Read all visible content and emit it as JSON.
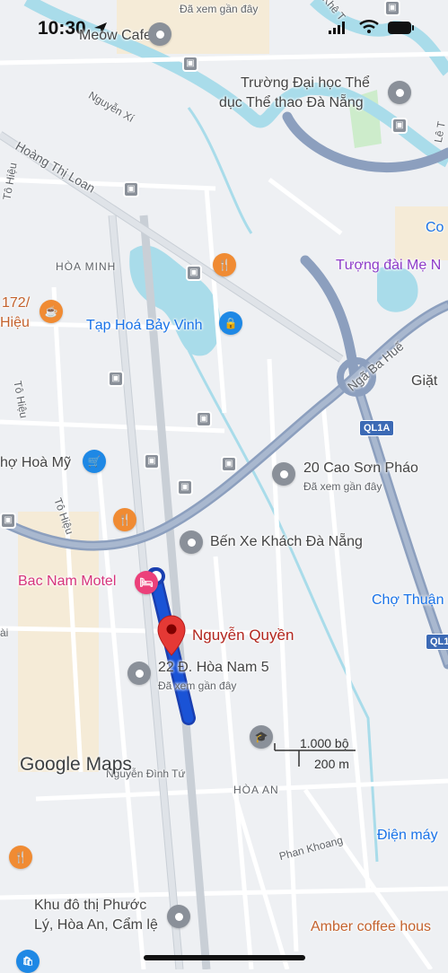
{
  "status_bar": {
    "time": "10:30"
  },
  "map": {
    "areas": {
      "hoa_minh": "HÒA MINH",
      "hoa_an": "HÒA AN"
    },
    "streets": {
      "nguyen_xi": "Nguyễn Xí",
      "hoang_thi_loan": "Hoàng Thị Loan",
      "to_hieu_1": "Tô Hiệu",
      "to_hieu_2": "Tô Hiệu",
      "to_hieu_3": "Tô Hiệu",
      "nga_ba_hue": "Ngã Ba Huế",
      "phan_khoang": "Phan Khoang",
      "nguyen_dinh_tu": "Nguyễn Đình Tứ",
      "bai": "ài",
      "partial_top": "Khê T",
      "partial_right": "Lê T"
    },
    "places": {
      "meow_cafe": "Meow Cafe",
      "top_seen": "Đã xem gần đây",
      "truong_dh": "Trường Đại học Thể dục Thể thao Đà Nẵng",
      "truong_dh_line1": "Trường Đại học Thể",
      "truong_dh_line2": "dục Thể thao Đà Nẵng",
      "tuong_dai": "Tượng đài Mẹ N",
      "co": "Co",
      "food_172_line1": "172/",
      "food_172_line2": "Hiệu",
      "tap_hoa": "Tạp Hoá Bảy Vinh",
      "giat": "Giặt",
      "cho_hoa_my": "hợ Hoà Mỹ",
      "cao_son_phao": "20 Cao Sơn Pháo",
      "cao_son_phao_seen": "Đã xem gần đây",
      "ben_xe": "Bến Xe Khách Đà Nẵng",
      "bac_nam_motel": "Bac Nam Motel",
      "cho_thuan": "Chợ Thuận",
      "nguyen_quyen": "Nguyễn Quyền",
      "hoa_nam": "22 Đ. Hòa Nam 5",
      "hoa_nam_seen": "Đã xem gần đây",
      "dien_may": "Điện máy",
      "khu_do_thi_line1": "Khu đô thị Phước",
      "khu_do_thi_line2": "Lý, Hòa An, Cẩm lệ",
      "amber": "Amber coffee hous"
    },
    "shields": {
      "ql1a_top": "QL1A",
      "ql1a_right": "QL1"
    },
    "scale": {
      "top": "1.000 bộ",
      "bottom": "200 m"
    },
    "logo": {
      "google": "Google",
      "maps": "Maps"
    },
    "route_color": "#1a53d6",
    "pin_color": "#e53935"
  }
}
